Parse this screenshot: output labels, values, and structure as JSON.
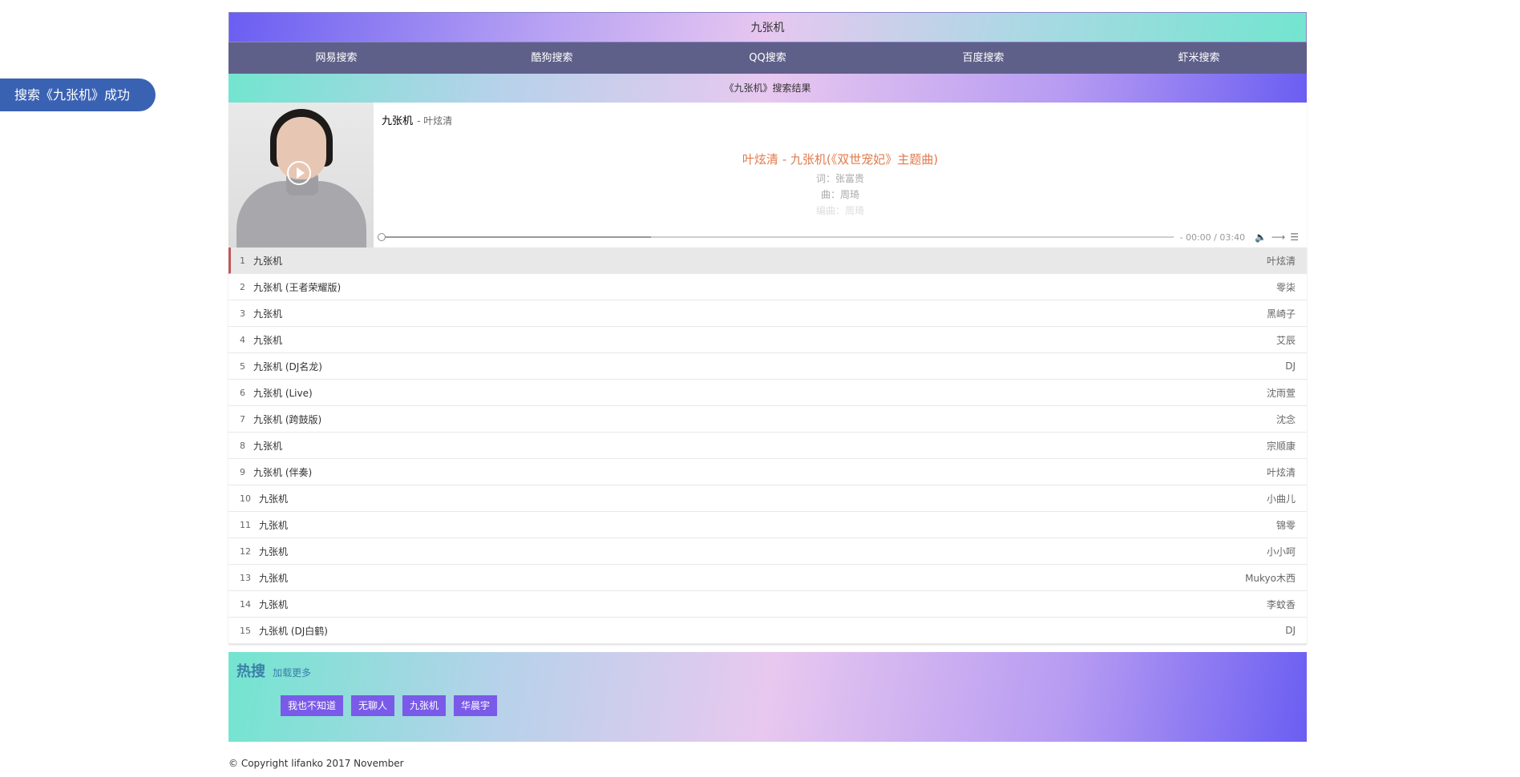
{
  "toast": "搜索《九张机》成功",
  "title": "九张机",
  "nav": [
    "网易搜索",
    "酷狗搜索",
    "QQ搜索",
    "百度搜索",
    "虾米搜索"
  ],
  "results_header": "《九张机》搜索结果",
  "player": {
    "song": "九张机",
    "artist": "- 叶炫清",
    "lyric_main": "叶炫清 - 九张机(《双世宠妃》主题曲)",
    "lyric_2": "词：张富贵",
    "lyric_3": "曲：周琦",
    "lyric_4": "编曲：周琦",
    "time": "- 00:00 / 03:40",
    "progress_loaded": 0.34
  },
  "songs": [
    {
      "num": "1",
      "title": "九张机",
      "artist": "叶炫清"
    },
    {
      "num": "2",
      "title": "九张机 (王者荣耀版)",
      "artist": "零柒"
    },
    {
      "num": "3",
      "title": "九张机",
      "artist": "黑崎子"
    },
    {
      "num": "4",
      "title": "九张机",
      "artist": "艾辰"
    },
    {
      "num": "5",
      "title": "九张机 (DJ名龙)",
      "artist": "DJ"
    },
    {
      "num": "6",
      "title": "九张机 (Live)",
      "artist": "沈雨萱"
    },
    {
      "num": "7",
      "title": "九张机 (跨鼓版)",
      "artist": "沈念"
    },
    {
      "num": "8",
      "title": "九张机",
      "artist": "宗顺康"
    },
    {
      "num": "9",
      "title": "九张机 (伴奏)",
      "artist": "叶炫清"
    },
    {
      "num": "10",
      "title": "九张机",
      "artist": "小曲儿"
    },
    {
      "num": "11",
      "title": "九张机",
      "artist": "锦零"
    },
    {
      "num": "12",
      "title": "九张机",
      "artist": "小小呵"
    },
    {
      "num": "13",
      "title": "九张机",
      "artist": "Mukyo木西"
    },
    {
      "num": "14",
      "title": "九张机",
      "artist": "李蚊香"
    },
    {
      "num": "15",
      "title": "九张机 (DJ白鹤)",
      "artist": "DJ"
    }
  ],
  "hot": {
    "title": "热搜",
    "more": "加载更多",
    "tags": [
      "我也不知道",
      "无聊人",
      "九张机",
      "华晨宇"
    ]
  },
  "copyright": "© Copyright lifanko 2017 November",
  "colors": {
    "accent": "#7a5ae8",
    "nav_bg": "#5f6089",
    "lyric": "#e07a4d",
    "toast": "#3a62b3"
  }
}
